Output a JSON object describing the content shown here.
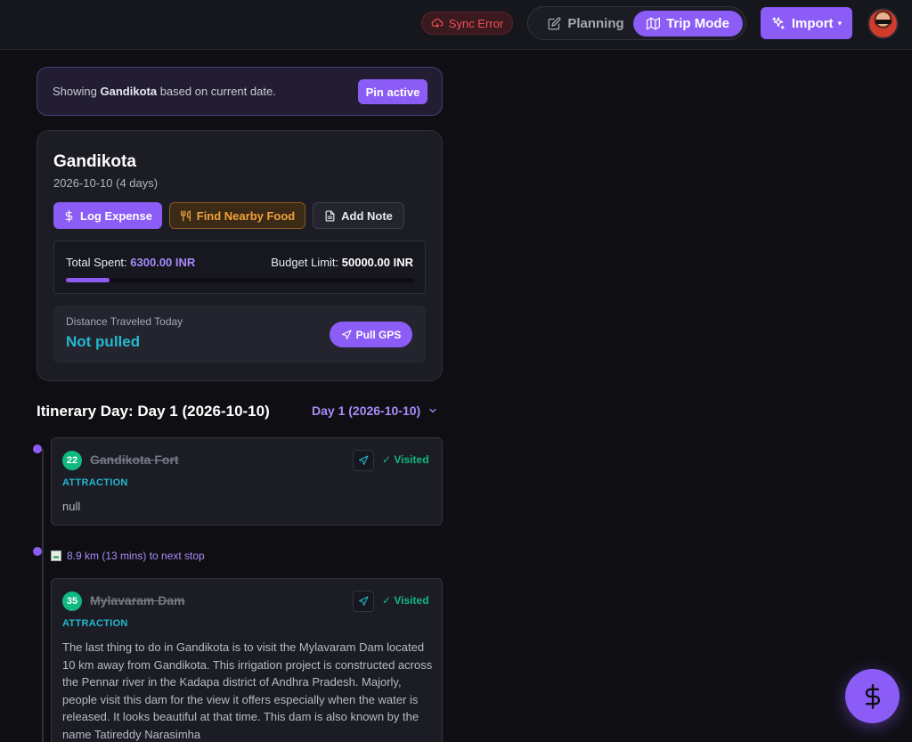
{
  "header": {
    "sync_error": "Sync Error",
    "planning_label": "Planning",
    "trip_mode_label": "Trip Mode",
    "import_label": "Import"
  },
  "banner": {
    "prefix": "Showing",
    "location": "Gandikota",
    "suffix": "based on current date.",
    "pin_label": "Pin active"
  },
  "location_card": {
    "title": "Gandikota",
    "subtitle": "2026-10-10 (4 days)",
    "log_expense_label": "Log Expense",
    "find_food_label": "Find Nearby Food",
    "add_note_label": "Add Note",
    "total_spent_label": "Total Spent:",
    "total_spent_value": "6300.00 INR",
    "budget_limit_label": "Budget Limit:",
    "budget_limit_value": "50000.00 INR",
    "budget_progress": 0.126,
    "distance_label": "Distance Traveled Today",
    "distance_value": "Not pulled",
    "pull_gps_label": "Pull GPS"
  },
  "itinerary": {
    "title": "Itinerary Day: Day 1 (2026-10-10)",
    "day_selector": "Day 1 (2026-10-10)",
    "stops": [
      {
        "number": "22",
        "name": "Gandikota Fort",
        "status": "Visited",
        "category": "ATTRACTION",
        "description": "null"
      },
      {
        "number": "35",
        "name": "Mylavaram Dam",
        "status": "Visited",
        "category": "ATTRACTION",
        "description": "The last thing to do in Gandikota is to visit the Mylavaram Dam located 10 km away from Gandikota. This irrigation project is constructed across the Pennar river in the Kadapa district of Andhra Pradesh. Majorly, people visit this dam for the view it offers especially when the water is released. It looks beautiful at that time. This dam is also known by the name Tatireddy Narasimha"
      }
    ],
    "travel_info": "8.9 km (13 mins) to next stop"
  },
  "colors": {
    "accent": "#8b5cf6",
    "visited": "#10b981",
    "category": "#22b8cf",
    "error": "#ef4f5a",
    "food": "#f0a23a"
  }
}
